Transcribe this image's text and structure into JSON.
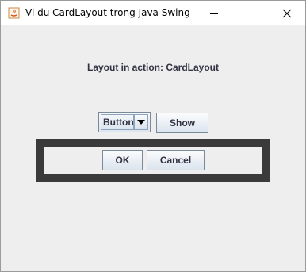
{
  "window": {
    "title": "Vi du CardLayout trong Java Swing",
    "controls": {
      "minimize_icon": "minimize-icon",
      "maximize_icon": "maximize-icon",
      "close_icon": "close-icon"
    }
  },
  "content": {
    "heading": "Layout in action: CardLayout",
    "combo": {
      "selected": "Button"
    },
    "show_button": "Show",
    "card": {
      "ok_button": "OK",
      "cancel_button": "Cancel"
    }
  },
  "colors": {
    "background": "#eeeeee",
    "card_border": "#3a3a3a",
    "button_text": "#333344"
  }
}
